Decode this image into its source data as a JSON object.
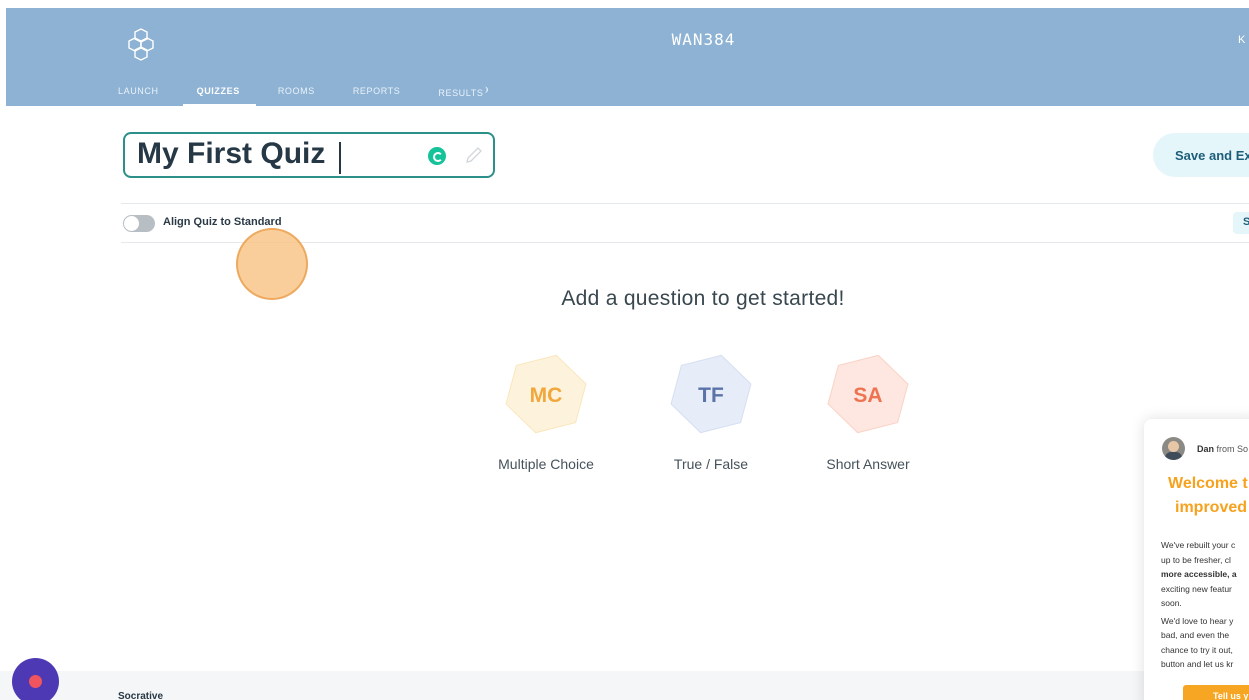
{
  "header": {
    "room_name": "WAN384",
    "user_initial": "K",
    "nav": [
      {
        "label": "LAUNCH",
        "active": false
      },
      {
        "label": "QUIZZES",
        "active": true
      },
      {
        "label": "ROOMS",
        "active": false
      },
      {
        "label": "REPORTS",
        "active": false
      },
      {
        "label": "RESULTS",
        "active": false
      }
    ]
  },
  "quiz": {
    "title": "My First Quiz",
    "save_label": "Save and Ex",
    "align_label": "Align Quiz to Standard",
    "align_enabled": false,
    "standard_chip": "S"
  },
  "empty_state": {
    "prompt": "Add a question to get started!"
  },
  "question_types": [
    {
      "abbr": "MC",
      "label": "Multiple Choice",
      "color": "#f0a83c",
      "bg": "#fdf3dc"
    },
    {
      "abbr": "TF",
      "label": "True / False",
      "color": "#5a73a8",
      "bg": "#e6ecf8"
    },
    {
      "abbr": "SA",
      "label": "Short Answer",
      "color": "#ee7350",
      "bg": "#fde7e0"
    }
  ],
  "chat": {
    "sender": "Dan",
    "sender_suffix": " from So",
    "title_line1": "Welcome t",
    "title_line2": "improved",
    "body_lines": [
      "We've rebuilt your c",
      "up to be fresher, cl",
      "more accessible, a",
      "exciting new featur",
      "soon."
    ],
    "body_lines2": [
      "We'd love to hear y",
      "bad, and even the",
      "chance to try it out,",
      "button and let us kr"
    ],
    "cta": "Tell us y"
  },
  "footer": {
    "brand": "Socrative"
  },
  "colors": {
    "header_bg": "#8db2d3",
    "accent_teal": "#2d8f8a",
    "chat_orange": "#f7a623",
    "help_button": "#4d39b3"
  }
}
